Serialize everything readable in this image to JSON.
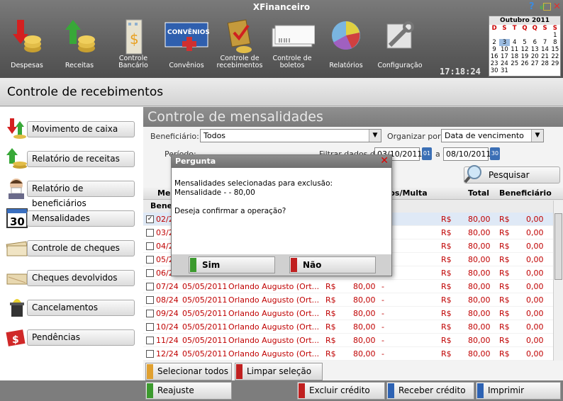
{
  "app": {
    "title": "XFinanceiro"
  },
  "window_controls": {
    "help": "?",
    "minimize": "⇙",
    "maximize": "□",
    "close": "✕"
  },
  "toolbar": [
    {
      "label": "Despesas",
      "icon": "despesas-icon"
    },
    {
      "label": "Receitas",
      "icon": "receitas-icon"
    },
    {
      "label": "Controle Bancário",
      "icon": "bank-icon"
    },
    {
      "label": "Convênios",
      "icon": "convenios-icon"
    },
    {
      "label": "Controle de recebimentos",
      "icon": "recebimentos-icon"
    },
    {
      "label": "Controle de boletos",
      "icon": "boletos-icon"
    },
    {
      "label": "Relatórios",
      "icon": "pie-chart-icon"
    },
    {
      "label": "Configuração",
      "icon": "tools-icon"
    }
  ],
  "clock": "17:18:24",
  "calendar": {
    "month": "Outubro 2011",
    "weekdays": [
      "D",
      "S",
      "T",
      "Q",
      "Q",
      "S",
      "S"
    ],
    "today": "3",
    "days": [
      "",
      "",
      "",
      "",
      "",
      "",
      "1",
      "2",
      "3",
      "4",
      "5",
      "6",
      "7",
      "8",
      "9",
      "10",
      "11",
      "12",
      "13",
      "14",
      "15",
      "16",
      "17",
      "18",
      "19",
      "20",
      "21",
      "22",
      "23",
      "24",
      "25",
      "26",
      "27",
      "28",
      "29",
      "30",
      "31",
      "",
      "",
      "",
      "",
      ""
    ]
  },
  "page": {
    "title": "Controle de recebimentos"
  },
  "sidebar": {
    "items": [
      {
        "label": "Movimento de caixa",
        "icon": "cash-movement-icon"
      },
      {
        "label": "Relatório de receitas",
        "icon": "income-report-icon"
      },
      {
        "label": "Relatório de beneficiários",
        "icon": "beneficiary-icon"
      },
      {
        "label": "Mensalidades",
        "icon": "calendar-30-icon"
      },
      {
        "label": "Controle de cheques",
        "icon": "cheque-icon"
      },
      {
        "label": "Cheques devolvidos",
        "icon": "returned-cheque-icon"
      },
      {
        "label": "Cancelamentos",
        "icon": "trash-icon"
      },
      {
        "label": "Pendências",
        "icon": "pending-icon"
      }
    ]
  },
  "main": {
    "heading": "Controle de mensalidades",
    "filters": {
      "beneficiario_label": "Beneficiário:",
      "beneficiario_value": "Todos",
      "organizar_label": "Organizar por:",
      "organizar_value": "Data de vencimento",
      "periodo_label": "Período:",
      "filtrar_label": "Filtrar dados de:",
      "date_from": "03/10/2011",
      "date_sep": "a",
      "date_to": "08/10/2011",
      "calendar_btn": "01",
      "calendar_btn2": "30"
    },
    "search_label": "Pesquisar",
    "columns": {
      "mensalidade": "Mensalidade",
      "juros": "Juros/Multa",
      "total": "Total",
      "beneficiario": "Beneficiário"
    },
    "group_label": "Beneficiário: Orlando Augusto",
    "rows": [
      {
        "checked": true,
        "parcela": "02/24",
        "vencimento": "",
        "nome": "",
        "rs1": "",
        "valor": "",
        "dash": "",
        "rs2": "R$",
        "total": "80,00",
        "rs3": "R$",
        "benef": "0,00"
      },
      {
        "checked": false,
        "parcela": "03/24",
        "vencimento": "",
        "nome": "",
        "rs1": "",
        "valor": "",
        "dash": "",
        "rs2": "R$",
        "total": "80,00",
        "rs3": "R$",
        "benef": "0,00"
      },
      {
        "checked": false,
        "parcela": "04/24",
        "vencimento": "",
        "nome": "",
        "rs1": "",
        "valor": "",
        "dash": "",
        "rs2": "R$",
        "total": "80,00",
        "rs3": "R$",
        "benef": "0,00"
      },
      {
        "checked": false,
        "parcela": "05/24",
        "vencimento": "",
        "nome": "",
        "rs1": "",
        "valor": "",
        "dash": "",
        "rs2": "R$",
        "total": "80,00",
        "rs3": "R$",
        "benef": "0,00"
      },
      {
        "checked": false,
        "parcela": "06/24",
        "vencimento": "",
        "nome": "",
        "rs1": "",
        "valor": "",
        "dash": "",
        "rs2": "R$",
        "total": "80,00",
        "rs3": "R$",
        "benef": "0,00"
      },
      {
        "checked": false,
        "parcela": "07/24",
        "vencimento": "05/05/2011",
        "nome": "Orlando Augusto (Ort...",
        "rs1": "R$",
        "valor": "80,00",
        "dash": "-",
        "rs2": "R$",
        "total": "80,00",
        "rs3": "R$",
        "benef": "0,00"
      },
      {
        "checked": false,
        "parcela": "08/24",
        "vencimento": "05/05/2011",
        "nome": "Orlando Augusto (Ort...",
        "rs1": "R$",
        "valor": "80,00",
        "dash": "-",
        "rs2": "R$",
        "total": "80,00",
        "rs3": "R$",
        "benef": "0,00"
      },
      {
        "checked": false,
        "parcela": "09/24",
        "vencimento": "05/05/2011",
        "nome": "Orlando Augusto (Ort...",
        "rs1": "R$",
        "valor": "80,00",
        "dash": "-",
        "rs2": "R$",
        "total": "80,00",
        "rs3": "R$",
        "benef": "0,00"
      },
      {
        "checked": false,
        "parcela": "10/24",
        "vencimento": "05/05/2011",
        "nome": "Orlando Augusto (Ort...",
        "rs1": "R$",
        "valor": "80,00",
        "dash": "-",
        "rs2": "R$",
        "total": "80,00",
        "rs3": "R$",
        "benef": "0,00"
      },
      {
        "checked": false,
        "parcela": "11/24",
        "vencimento": "05/05/2011",
        "nome": "Orlando Augusto (Ort...",
        "rs1": "R$",
        "valor": "80,00",
        "dash": "-",
        "rs2": "R$",
        "total": "80,00",
        "rs3": "R$",
        "benef": "0,00"
      },
      {
        "checked": false,
        "parcela": "12/24",
        "vencimento": "05/05/2011",
        "nome": "Orlando Augusto (Ort...",
        "rs1": "R$",
        "valor": "80,00",
        "dash": "-",
        "rs2": "R$",
        "total": "80,00",
        "rs3": "R$",
        "benef": "0,00"
      }
    ],
    "buttons": {
      "select_all": "Selecionar todos",
      "clear": "Limpar seleção"
    }
  },
  "footer": {
    "reajuste": "Reajuste",
    "excluir": "Excluir crédito",
    "receber": "Receber crédito",
    "imprimir": "Imprimir"
  },
  "dialog": {
    "title": "Pergunta",
    "line1": "Mensalidades selecionadas para exclusão:",
    "line2": "Mensalidade -  - 80,00",
    "line3": "Deseja confirmar a operação?",
    "yes": "Sim",
    "no": "Não"
  },
  "colors": {
    "accent_red": "#c00000",
    "green": "#3c9a2e",
    "blue": "#2d62b3",
    "orange": "#d98a1c"
  }
}
